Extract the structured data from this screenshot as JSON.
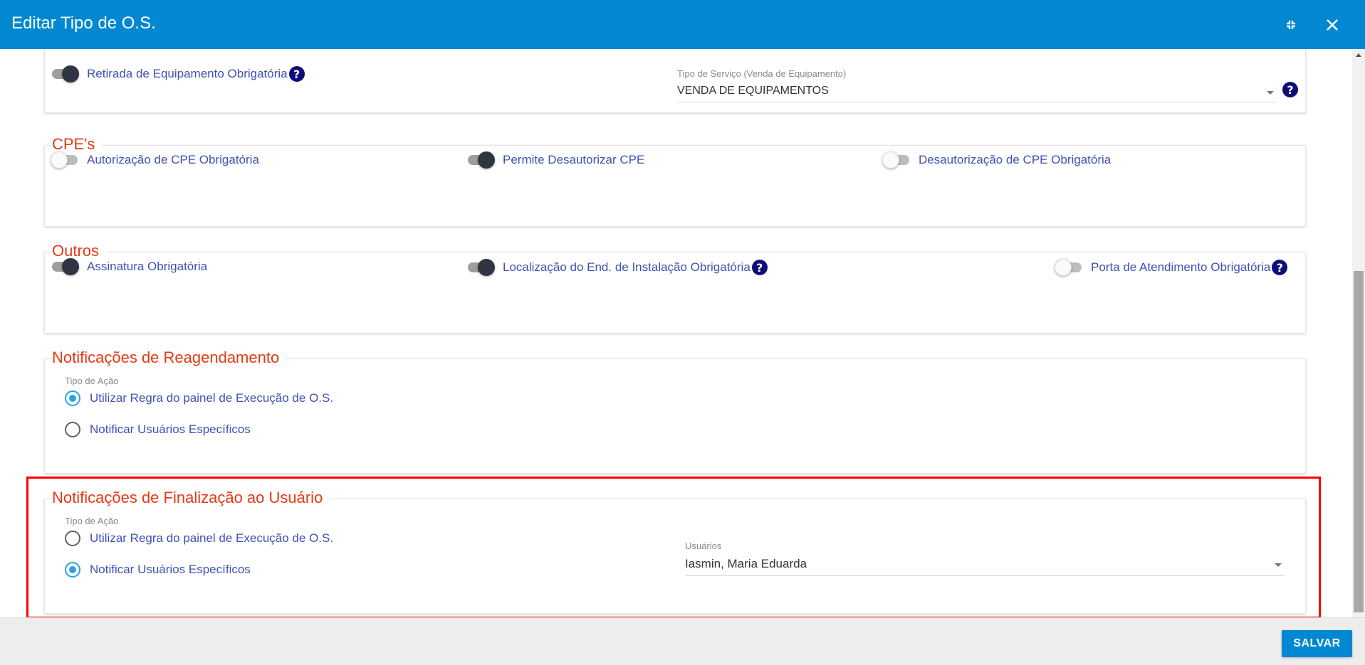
{
  "window": {
    "title": "Editar Tipo de O.S.",
    "minimize_icon": "compress-icon",
    "close_icon": "close-icon"
  },
  "equipamento": {
    "toggle_retirada": {
      "label": "Retirada de Equipamento Obrigatória",
      "on": true
    },
    "tipo_servico": {
      "label": "Tipo de Serviço (Venda de Equipamento)",
      "value": "VENDA DE EQUIPAMENTOS"
    }
  },
  "cpes": {
    "title": "CPE's",
    "toggles": [
      {
        "label": "Autorização de CPE Obrigatória",
        "on": false
      },
      {
        "label": "Permite Desautorizar CPE",
        "on": true
      },
      {
        "label": "Desautorização de CPE Obrigatória",
        "on": false
      }
    ]
  },
  "outros": {
    "title": "Outros",
    "toggles": [
      {
        "label": "Assinatura Obrigatória",
        "on": true
      },
      {
        "label": "Localização do End. de Instalação Obrigatória",
        "on": true
      },
      {
        "label": "Porta de Atendimento Obrigatória",
        "on": false
      }
    ]
  },
  "reagendamento": {
    "title": "Notificações de Reagendamento",
    "group_label": "Tipo de Ação",
    "options": [
      {
        "label": "Utilizar Regra do painel de Execução de O.S.",
        "checked": true
      },
      {
        "label": "Notificar Usuários Específicos",
        "checked": false
      }
    ]
  },
  "finalizacao": {
    "title": "Notificações de Finalização ao Usuário",
    "group_label": "Tipo de Ação",
    "options": [
      {
        "label": "Utilizar Regra do painel de Execução de O.S.",
        "checked": false
      },
      {
        "label": "Notificar Usuários Específicos",
        "checked": true
      }
    ],
    "usuarios": {
      "label": "Usuários",
      "value": "Iasmin, Maria Eduarda"
    }
  },
  "help_glyph": "?",
  "footer": {
    "save_label": "SALVAR"
  },
  "colors": {
    "header_bg": "#0288d1",
    "section_title": "#e53915",
    "label_text": "#3f51b5",
    "radio_checked": "#29a3e0",
    "help_icon_bg": "#0d0d7a",
    "highlight_border": "#ff0000"
  }
}
